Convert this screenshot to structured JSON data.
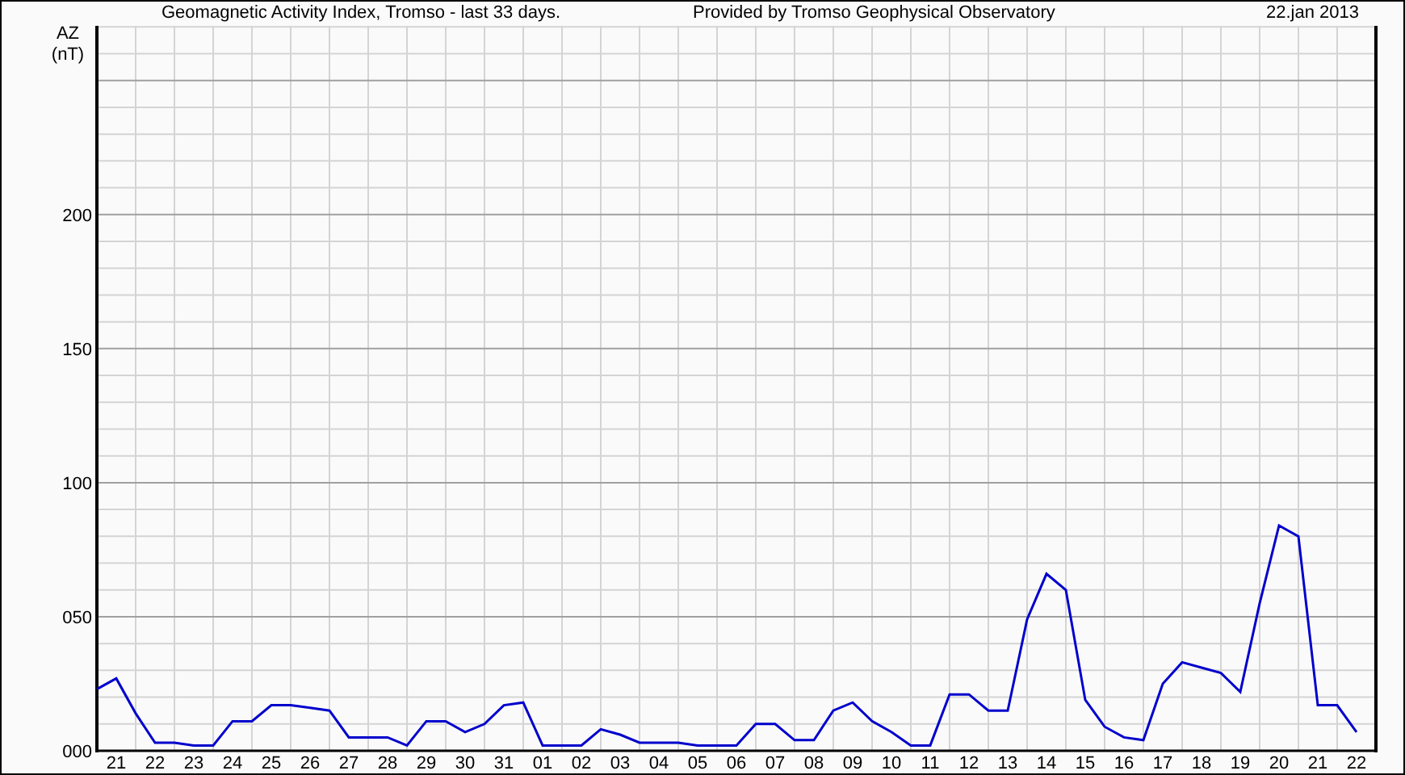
{
  "header": {
    "title": "Geomagnetic Activity Index, Tromso - last 33 days.",
    "provider": "Provided by Tromso Geophysical Observatory",
    "date": "22.jan 2013"
  },
  "chart": {
    "chart_data": {
      "type": "line",
      "grid": true,
      "ylabel": "AZ (nT)",
      "ylim": [
        0,
        271
      ],
      "yticks": [
        {
          "value": 0,
          "label": "000"
        },
        {
          "value": 50,
          "label": "050"
        },
        {
          "value": 100,
          "label": "100"
        },
        {
          "value": 150,
          "label": "150"
        },
        {
          "value": 200,
          "label": "200"
        }
      ],
      "categories": [
        null,
        "21",
        null,
        "22",
        null,
        "23",
        null,
        "24",
        null,
        "25",
        null,
        "26",
        null,
        "27",
        null,
        "28",
        null,
        "29",
        null,
        "30",
        null,
        "31",
        null,
        "01",
        null,
        "02",
        null,
        "03",
        null,
        "04",
        null,
        "05",
        null,
        "06",
        null,
        "07",
        null,
        "08",
        null,
        "09",
        null,
        "10",
        null,
        "11",
        null,
        "12",
        null,
        "13",
        null,
        "14",
        null,
        "15",
        null,
        "16",
        null,
        "17",
        null,
        "18",
        null,
        "19",
        null,
        "20",
        null,
        "21",
        null,
        "22"
      ],
      "series": [
        {
          "color": "#0000cc",
          "values": [
            23,
            27,
            14,
            3,
            3,
            2,
            2,
            11,
            11,
            17,
            17,
            16,
            15,
            5,
            5,
            5,
            2,
            11,
            11,
            7,
            10,
            17,
            18,
            2,
            2,
            2,
            8,
            6,
            3,
            3,
            3,
            2,
            2,
            2,
            10,
            10,
            4,
            4,
            15,
            18,
            11,
            7,
            2,
            2,
            21,
            21,
            15,
            15,
            49,
            66,
            60,
            19,
            9,
            5,
            4,
            25,
            33,
            31,
            29,
            22,
            55,
            84,
            80,
            17,
            17,
            7
          ]
        }
      ]
    }
  }
}
